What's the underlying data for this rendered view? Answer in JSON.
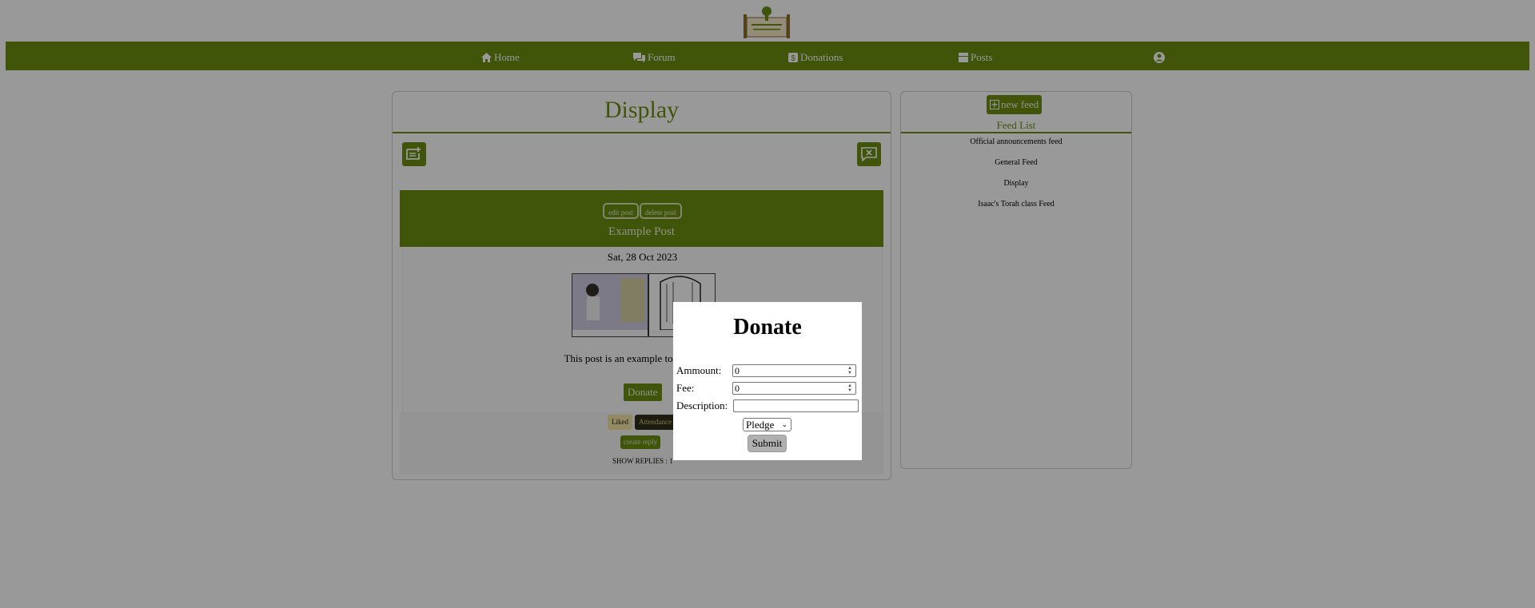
{
  "nav": {
    "items": [
      {
        "label": "Home",
        "icon": "home-icon"
      },
      {
        "label": "Forum",
        "icon": "forum-icon"
      },
      {
        "label": "Donations",
        "icon": "dollar-icon"
      },
      {
        "label": "Posts",
        "icon": "posts-icon"
      },
      {
        "label": "",
        "icon": "account-icon"
      }
    ]
  },
  "display": {
    "title": "Display"
  },
  "post": {
    "edit_label": "edit post",
    "delete_label": "delete post",
    "title": "Example Post",
    "date": "Sat, 28 Oct 2023",
    "text": "This post is an example to display the",
    "donate_label": "Donate",
    "liked_label": "Liked",
    "attendance_label": "Attendance",
    "reply_label": "create reply",
    "show_replies": "SHOW REPLIES : 1"
  },
  "feeds": {
    "new_feed_label": "new feed",
    "list_label": "Feed List",
    "items": [
      "Official announcements feed",
      "General Feed",
      "Display",
      "Isaac's Torah class Feed"
    ]
  },
  "modal": {
    "title": "Donate",
    "amount_label": "Ammount:",
    "amount_value": "0",
    "fee_label": "Fee:",
    "fee_value": "0",
    "description_label": "Description:",
    "description_value": "",
    "type_selected": "Pledge",
    "submit_label": "Submit"
  },
  "colors": {
    "brand": "#6b8e0f",
    "overlay": "rgba(0,0,0,0.40)"
  }
}
